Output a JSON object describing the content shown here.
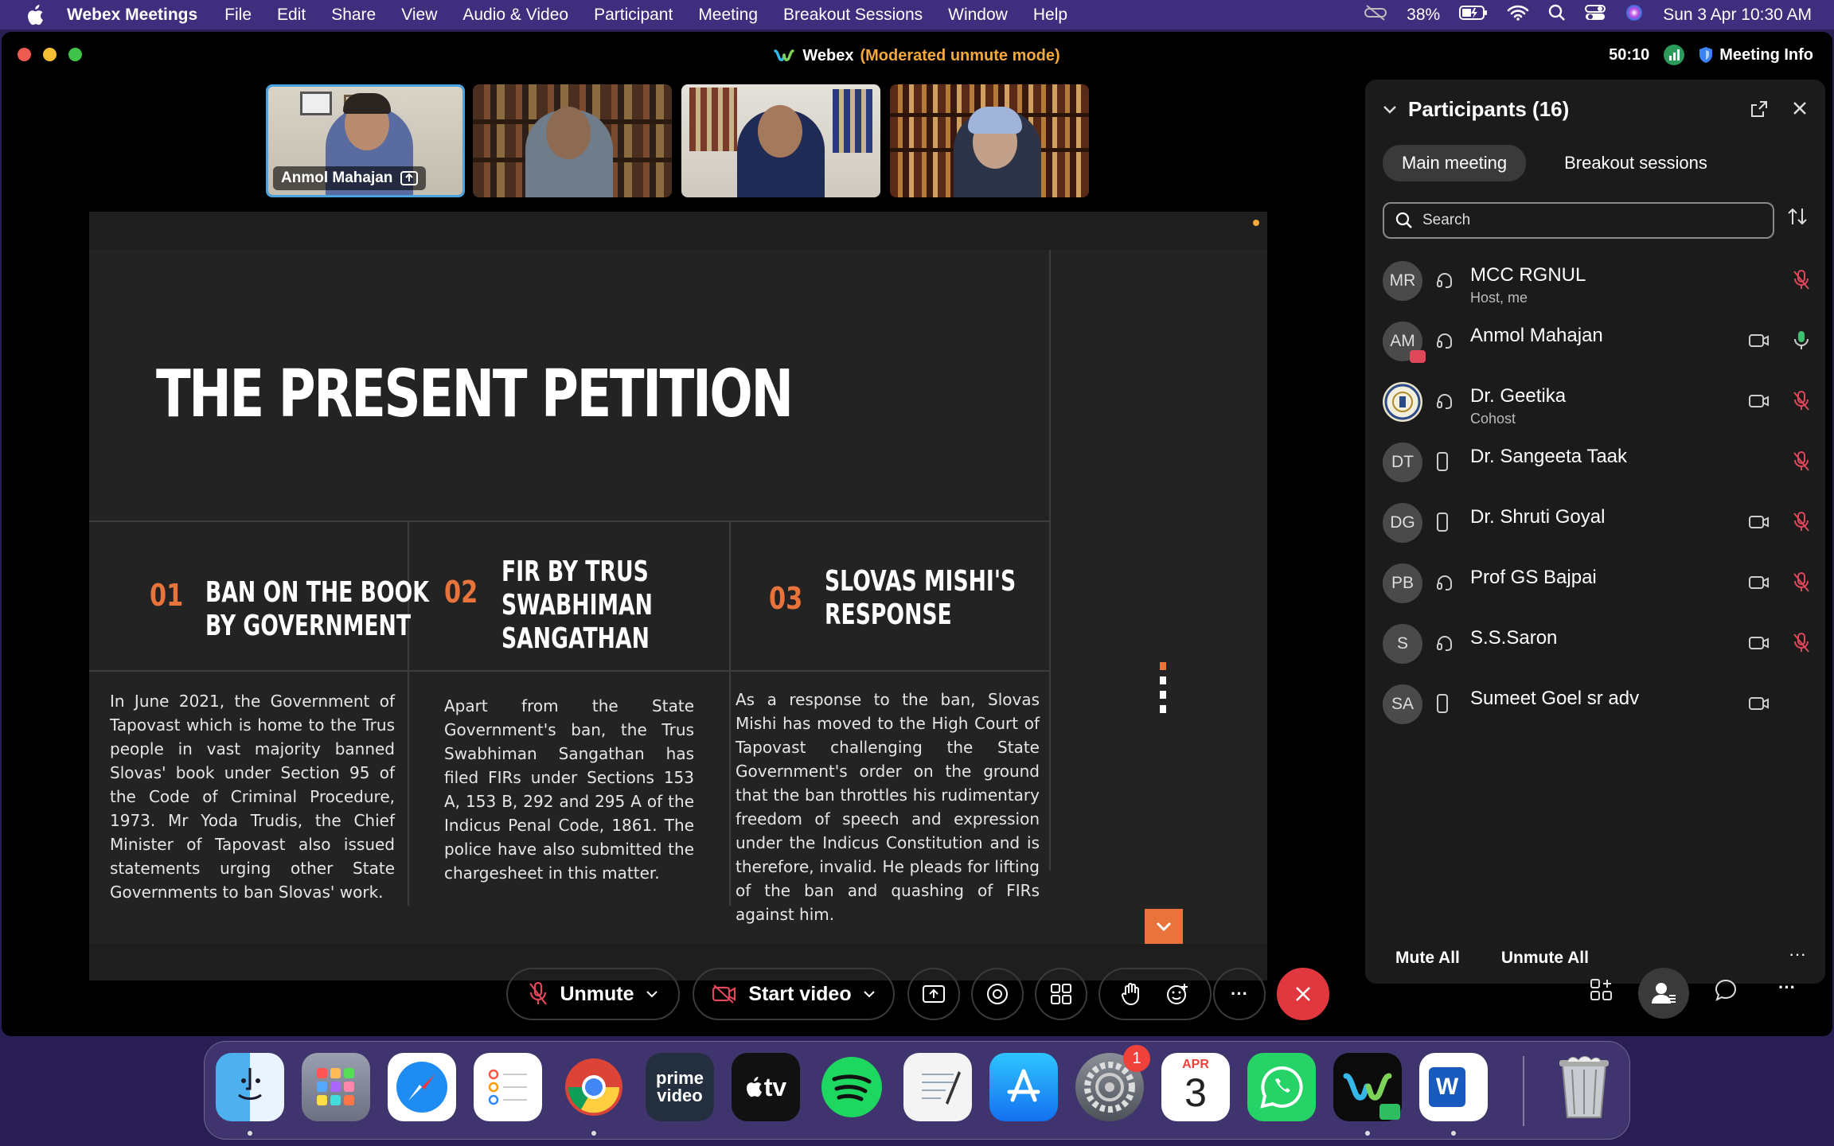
{
  "menubar": {
    "app_name": "Webex Meetings",
    "items": [
      "File",
      "Edit",
      "Share",
      "View",
      "Audio & Video",
      "Participant",
      "Meeting",
      "Breakout Sessions",
      "Window",
      "Help"
    ],
    "battery": "38%",
    "datetime": "Sun 3 Apr  10:30 AM"
  },
  "window": {
    "title": "Webex",
    "mode": "(Moderated unmute mode)",
    "timer": "50:10",
    "meeting_info": "Meeting Info"
  },
  "thumbnails": [
    {
      "name": "Anmol Mahajan",
      "active": true
    },
    {
      "name": "",
      "active": false
    },
    {
      "name": "",
      "active": false
    },
    {
      "name": "",
      "active": false
    }
  ],
  "slide": {
    "title": "THE PRESENT PETITION",
    "columns": [
      {
        "number": "01",
        "heading": "BAN ON THE BOOK\nBY GOVERNMENT",
        "body": "In June 2021, the Government of Tapovast which is home to the Trus people in vast majority banned Slovas' book under Section 95 of the Code of Criminal Procedure, 1973. Mr Yoda Trudis, the Chief Minister of Tapovast also issued statements urging other State Governments to ban Slovas' work."
      },
      {
        "number": "02",
        "heading": "FIR BY TRUS\nSWABHIMAN\nSANGATHAN",
        "body": "Apart from the State Government's ban, the Trus Swabhiman Sangathan has filed FIRs under Sections 153 A, 153 B, 292 and 295 A of the Indicus Penal Code, 1861. The police have also submitted the chargesheet in this matter."
      },
      {
        "number": "03",
        "heading": "SLOVAS MISHI'S\nRESPONSE",
        "body": "As a response to the ban, Slovas Mishi has moved to the High Court of Tapovast challenging the State Government's order on the ground that the ban throttles his rudimentary freedom of speech and expression under the Indicus Constitution and is therefore, invalid. He pleads for lifting of the ban and quashing of FIRs against him."
      }
    ]
  },
  "participants": {
    "header": "Participants (16)",
    "tabs": [
      "Main meeting",
      "Breakout sessions"
    ],
    "search_placeholder": "Search",
    "list": [
      {
        "initials": "MR",
        "name": "MCC RGNUL",
        "role": "Host, me",
        "device": "headset",
        "camera": false,
        "mic": "muted"
      },
      {
        "initials": "AM",
        "name": "Anmol Mahajan",
        "role": "",
        "device": "headset",
        "camera": true,
        "mic": "active",
        "sharing": true
      },
      {
        "initials": "",
        "name": "Dr. Geetika",
        "role": "Cohost",
        "device": "headset",
        "camera": true,
        "mic": "muted",
        "emblem": true
      },
      {
        "initials": "DT",
        "name": "Dr. Sangeeta Taak",
        "role": "",
        "device": "phone",
        "camera": false,
        "mic": "muted"
      },
      {
        "initials": "DG",
        "name": "Dr. Shruti Goyal",
        "role": "",
        "device": "phone",
        "camera": true,
        "mic": "muted"
      },
      {
        "initials": "PB",
        "name": "Prof GS Bajpai",
        "role": "",
        "device": "headset",
        "camera": true,
        "mic": "muted"
      },
      {
        "initials": "S",
        "name": "S.S.Saron",
        "role": "",
        "device": "headset",
        "camera": true,
        "mic": "muted"
      },
      {
        "initials": "SA",
        "name": "Sumeet Goel sr adv",
        "role": "",
        "device": "phone",
        "camera": true,
        "mic": "none"
      }
    ],
    "mute_all": "Mute All",
    "unmute_all": "Unmute All",
    "more": "···"
  },
  "controls": {
    "unmute": "Unmute",
    "start_video": "Start video",
    "more": "···"
  },
  "dock": {
    "apps": [
      "Finder",
      "Launchpad",
      "Safari",
      "Reminders",
      "Chrome",
      "Prime Video",
      "Apple TV",
      "Spotify",
      "TextEdit",
      "App Store",
      "System Preferences",
      "Calendar",
      "WhatsApp",
      "Webex",
      "Word",
      "Trash"
    ],
    "prime_label_1": "prime",
    "prime_label_2": "video",
    "tv_label": "tv",
    "calendar_month": "APR",
    "calendar_day": "3",
    "settings_badge": "1",
    "word_letter": "W"
  },
  "colors": {
    "accent_orange": "#e9743b",
    "mode_orange": "#f3a93c",
    "end_red": "#e0383e",
    "mute_red": "#e0475b",
    "mic_green": "#3fbf6f",
    "menubar": "#3f2d7d"
  }
}
